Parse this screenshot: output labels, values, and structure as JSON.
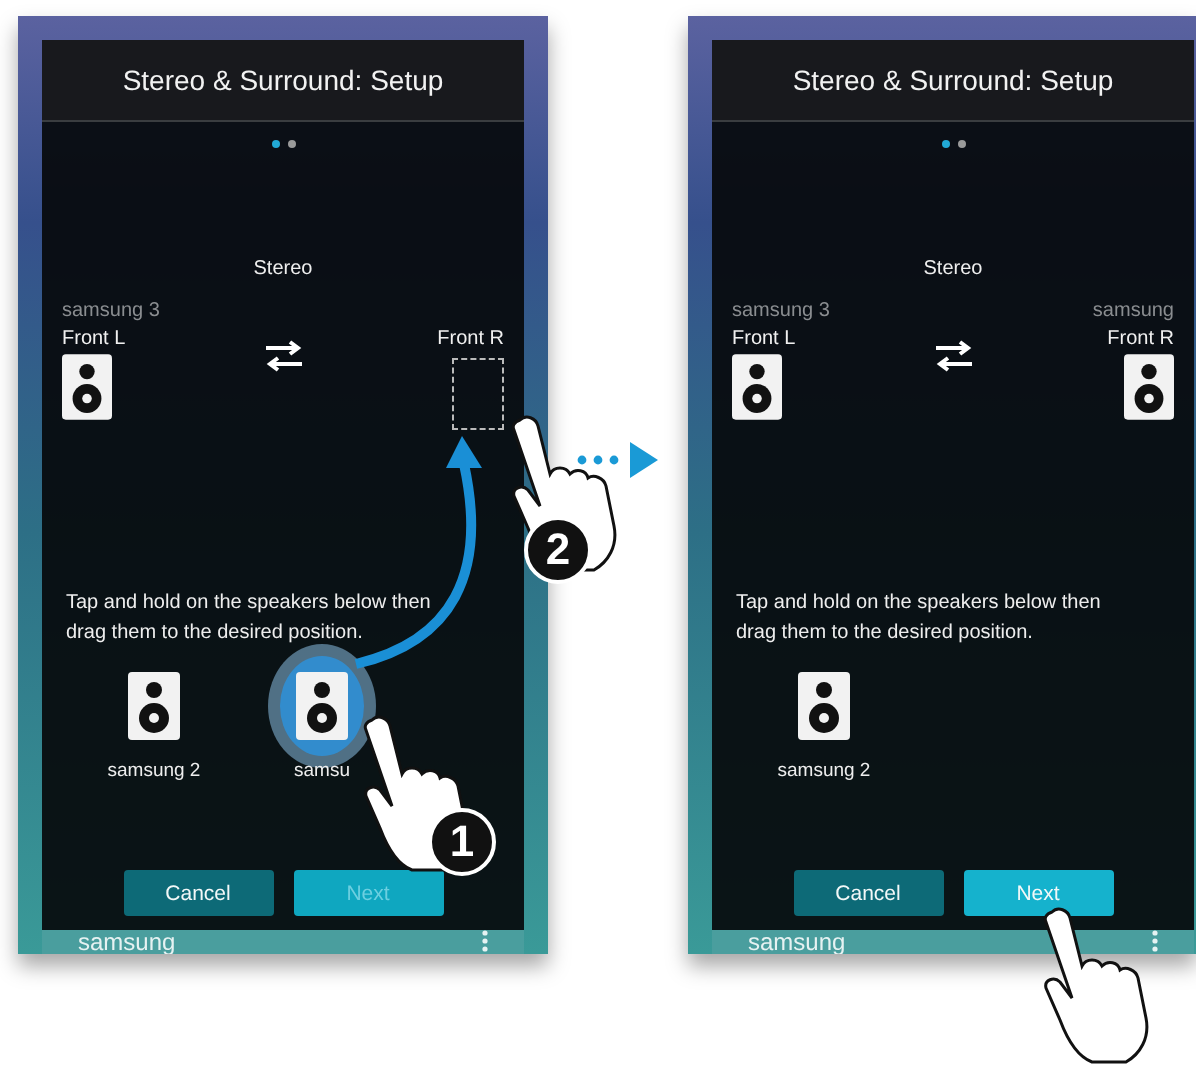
{
  "screens": [
    {
      "dialog_title": "Stereo & Surround: Setup",
      "page_dots": [
        {
          "selected": true
        },
        {
          "selected": false
        }
      ],
      "mode": "Stereo",
      "slots": [
        {
          "position": "Front L",
          "name": "samsung 3",
          "filled": true
        },
        {
          "position": "Front R",
          "filled": false
        }
      ],
      "instruction": "Tap and hold on the speakers below then drag them to the desired position.",
      "tray": [
        {
          "name": "samsung 2",
          "touched": false
        },
        {
          "name": "samsu",
          "touched": true
        }
      ],
      "buttons": [
        {
          "label": "Cancel",
          "kind": "cancel",
          "disabled": false
        },
        {
          "label": "Next",
          "kind": "next",
          "disabled": true
        }
      ],
      "footer": "samsung",
      "gestures": [
        {
          "kind": "hold",
          "badge": "1"
        },
        {
          "kind": "drop",
          "badge": "2"
        }
      ]
    },
    {
      "dialog_title": "Stereo & Surround: Setup",
      "page_dots": [
        {
          "selected": true
        },
        {
          "selected": false
        }
      ],
      "mode": "Stereo",
      "slots": [
        {
          "position": "Front L",
          "name": "samsung 3",
          "filled": true
        },
        {
          "position": "Front R",
          "name": "samsung",
          "filled": true
        }
      ],
      "instruction": "Tap and hold on the speakers below then drag them to the desired position.",
      "tray": [
        {
          "name": "samsung 2",
          "touched": false
        }
      ],
      "buttons": [
        {
          "label": "Cancel",
          "kind": "cancel",
          "disabled": false
        },
        {
          "label": "Next",
          "kind": "next",
          "disabled": false
        }
      ],
      "footer": "samsung",
      "gestures": [
        {
          "kind": "tap"
        }
      ]
    }
  ]
}
